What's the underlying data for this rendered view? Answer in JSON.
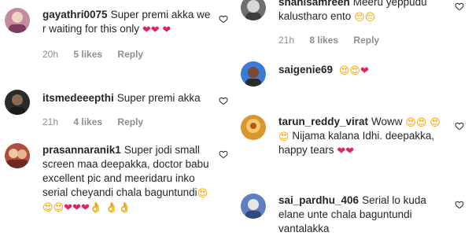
{
  "left": [
    {
      "username": "gayathri0075",
      "text": "Super premi akka we r waiting for this only",
      "emojis": [
        "❤",
        "❤",
        "❤"
      ],
      "time": "20h",
      "likes": "5 likes",
      "reply": "Reply",
      "avatar_color": "#c58aa2"
    },
    {
      "username": "itsmedeeepthi",
      "text": "Super premi akka",
      "emojis": [],
      "time": "21h",
      "likes": "4 likes",
      "reply": "Reply",
      "avatar_color": "#2b2b2b"
    },
    {
      "username": "prasannaranik1",
      "text": "Super jodi small screen maa deepakka, doctor babu excellent pic and meeridaru inko serial cheyandi chala baguntundi",
      "emojis": [
        "😍",
        "😍",
        "😍",
        "❤",
        "❤",
        "❤",
        "👌",
        "👌",
        "👌"
      ],
      "avatar_color": "#b04d3c"
    }
  ],
  "right": [
    {
      "username": "shahisamreen",
      "text": "Meeru yeppudu kalustharo ento",
      "emojis": [
        "😔",
        "😔"
      ],
      "time": "21h",
      "likes": "8 likes",
      "reply": "Reply",
      "avatar_color": "#6f6f6f"
    },
    {
      "username": "saigenie69",
      "text": "",
      "emojis": [
        "😍",
        "😍",
        "❤"
      ],
      "avatar_color": "#3a7bd5"
    },
    {
      "username": "tarun_reddy_virat",
      "text": "Woww",
      "emojis": [
        "😍",
        "😍",
        "😍",
        "😍"
      ],
      "text2": "Nijama kalana Idhi. deepakka, happy tears",
      "emojis2": [
        "❤",
        "❤"
      ],
      "avatar_color": "#d9962e"
    },
    {
      "username": "sai_pardhu_406",
      "text": "Serial lo kuda elane unte chala baguntundi vantalakka",
      "emojis": [],
      "avatar_color": "#5f7fbf"
    }
  ]
}
